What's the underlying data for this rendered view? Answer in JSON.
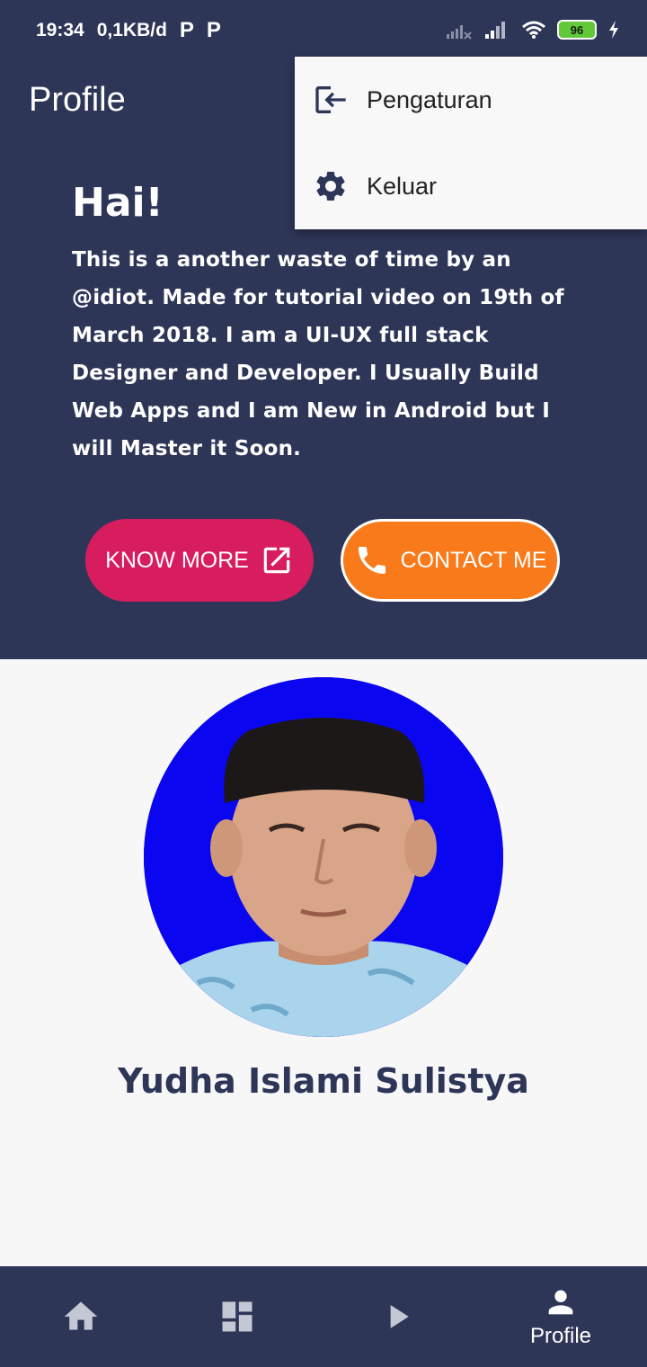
{
  "status_bar": {
    "time": "19:34",
    "data_rate": "0,1KB/d",
    "app_icons": [
      "P",
      "P"
    ],
    "battery_level": "96"
  },
  "app_bar": {
    "title": "Profile"
  },
  "menu": {
    "items": [
      {
        "label": "Pengaturan",
        "icon": "login-icon"
      },
      {
        "label": "Keluar",
        "icon": "gear-icon"
      }
    ]
  },
  "hero": {
    "greeting": "Hai!",
    "bio": "This is a another waste of time by an @idiot. Made for tutorial video on 19th of March 2018. I am a UI-UX full stack Designer and Developer. I Usually Build Web Apps and I am New in Android but I will Master it Soon.",
    "know_more_label": "KNOW MORE",
    "contact_label": "CONTACT ME"
  },
  "profile": {
    "name": "Yudha Islami Sulistya"
  },
  "bottom_nav": {
    "items": [
      {
        "icon": "home-icon",
        "label": ""
      },
      {
        "icon": "dashboard-icon",
        "label": ""
      },
      {
        "icon": "play-icon",
        "label": ""
      },
      {
        "icon": "person-icon",
        "label": "Profile"
      }
    ],
    "active_index": 3
  },
  "colors": {
    "primary": "#2e3658",
    "know_more_button": "#d81d5f",
    "contact_button": "#f97a1a",
    "avatar_background": "#0b06f0",
    "battery_fill": "#61c83a"
  }
}
